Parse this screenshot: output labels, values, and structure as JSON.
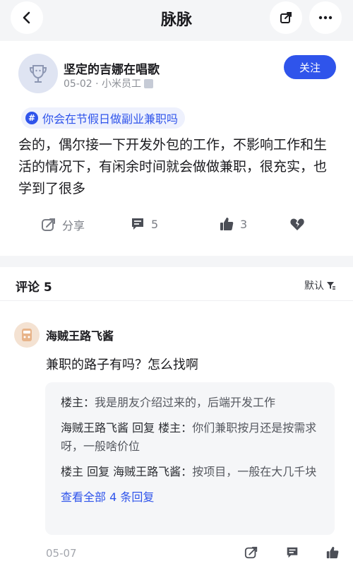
{
  "header": {
    "title": "脉脉"
  },
  "post": {
    "author": "坚定的吉娜在唱歌",
    "meta": "05-02 · 小米员工",
    "follow_label": "关注",
    "topic": "你会在节假日做副业兼职吗",
    "body": "会的，偶尔接一下开发外包的工作，不影响工作和生活的情况下，有闲余时间就会做做兼职，很充实，也学到了很多",
    "actions": {
      "share_label": "分享",
      "comment_count": "5",
      "like_count": "3"
    }
  },
  "comments": {
    "header": "评论 5",
    "sort_label": "默认",
    "items": [
      {
        "author": "海贼王路飞酱",
        "text": "兼职的路子有吗？怎么找啊",
        "replies": [
          {
            "name": "楼主：",
            "text": "我是朋友介绍过来的，后端开发工作"
          },
          {
            "name": "海贼王路飞酱 回复 楼主：",
            "text": "你们兼职按月还是按需求呀，一般啥价位"
          },
          {
            "name": "楼主 回复 海贼王路飞酱：",
            "text": "按项目，一般在大几千块"
          }
        ],
        "view_all": "查看全部 4 条回复",
        "date": "05-07"
      }
    ]
  },
  "colors": {
    "accent": "#2f54eb",
    "background": "#f4f5f7"
  }
}
